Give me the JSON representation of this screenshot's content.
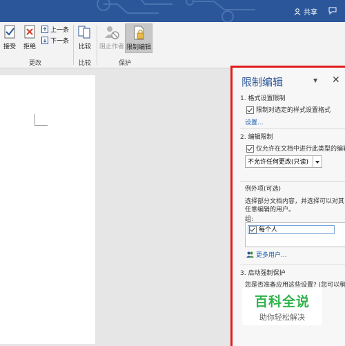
{
  "titlebar": {
    "share_label": "共享",
    "accent": "#2b579a"
  },
  "ribbon": {
    "accept_label": "接受",
    "reject_label": "拒绝",
    "prev_label": "上一条",
    "next_label": "下一条",
    "changes_group": "更改",
    "compare_label": "比较",
    "compare_group": "比较",
    "block_authors_label": "阻止作者",
    "restrict_label": "限制编辑",
    "protect_group": "保护"
  },
  "pane": {
    "title": "限制编辑",
    "section1_title": "1. 格式设置限制",
    "section1_checkbox": "限制对选定的样式设置格式",
    "section1_link": "设置...",
    "section2_title": "2. 编辑限制",
    "section2_checkbox": "仅允许在文档中进行此类型的编辑",
    "section2_dropdown": "不允许任何更改(只读)",
    "exceptions_title": "例外项(可选)",
    "exceptions_desc_line1": "选择部分文档内容，并选择可以对其",
    "exceptions_desc_line2": "任意编辑的用户。",
    "groups_label": "组:",
    "group_item": "每个人",
    "more_users": "更多用户...",
    "section3_title": "3. 启动强制保护",
    "section3_desc": "您是否准备应用这些设置? (您可以稍"
  },
  "watermark": {
    "big": "百科全说",
    "small": "助你轻松解决"
  },
  "colors": {
    "highlight_border": "#e21b1b",
    "link": "#1e5fb4",
    "watermark_green": "#2eb34a"
  }
}
